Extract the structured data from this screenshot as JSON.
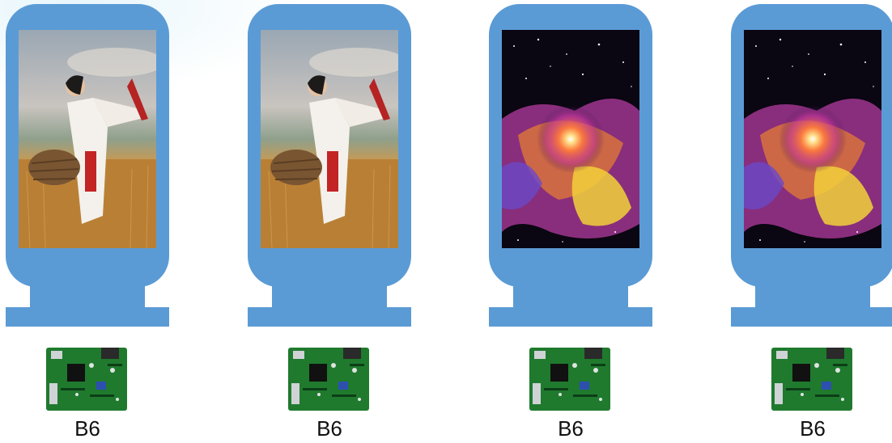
{
  "devices": [
    {
      "label": "B6",
      "scene": "wheat-field-dancer"
    },
    {
      "label": "B6",
      "scene": "wheat-field-dancer"
    },
    {
      "label": "B6",
      "scene": "cosmic-nebula"
    },
    {
      "label": "B6",
      "scene": "cosmic-nebula"
    }
  ],
  "colors": {
    "cabinet": "#5b9bd5",
    "board": "#1f7a2e",
    "label_text": "#111111"
  }
}
